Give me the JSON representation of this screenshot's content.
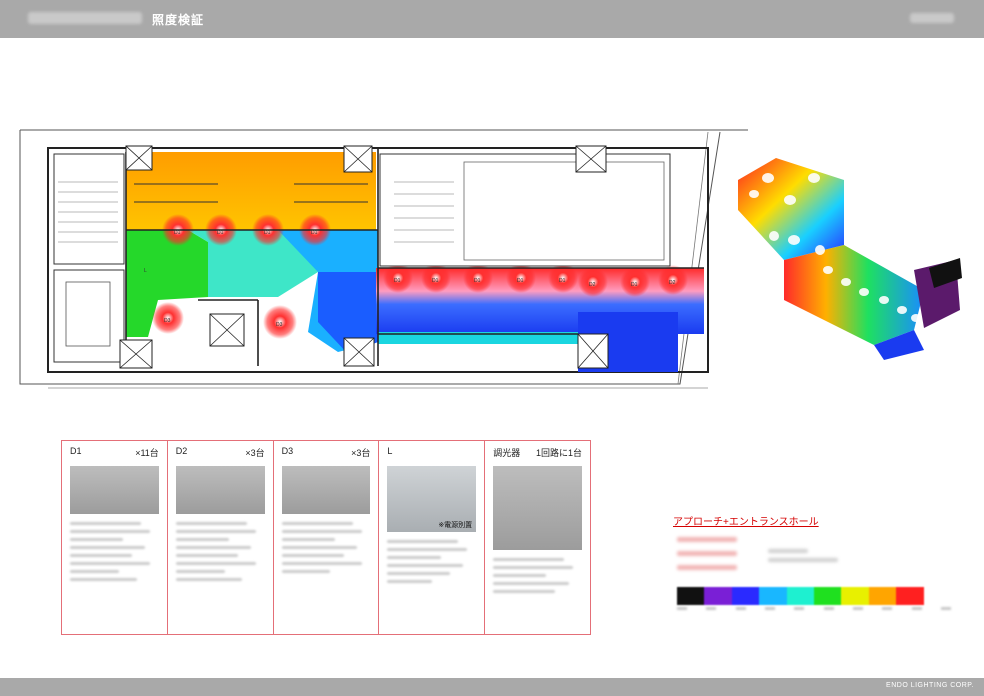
{
  "header": {
    "title": "照度検証"
  },
  "footer": {
    "company": "ENDO LIGHTING CORP."
  },
  "fixtures": [
    {
      "name": "D1",
      "qty": "×11台"
    },
    {
      "name": "D2",
      "qty": "×3台"
    },
    {
      "name": "D3",
      "qty": "×3台"
    },
    {
      "name": "L",
      "qty": "",
      "note": "※電源別置"
    },
    {
      "name": "調光器",
      "qty": "1回路に1台"
    }
  ],
  "legend": {
    "title": "アプローチ+エントランスホール"
  },
  "plan_labels": [
    "D1",
    "D2",
    "D3",
    "L"
  ],
  "colors": {
    "accent": "#d40000",
    "bar": "#a9a9a9",
    "scale": [
      "#111111",
      "#7a1fd6",
      "#2a2aff",
      "#19b7ff",
      "#1ef0d0",
      "#1fe01f",
      "#e8f000",
      "#ffa500",
      "#ff2020",
      "#ffffff"
    ]
  }
}
